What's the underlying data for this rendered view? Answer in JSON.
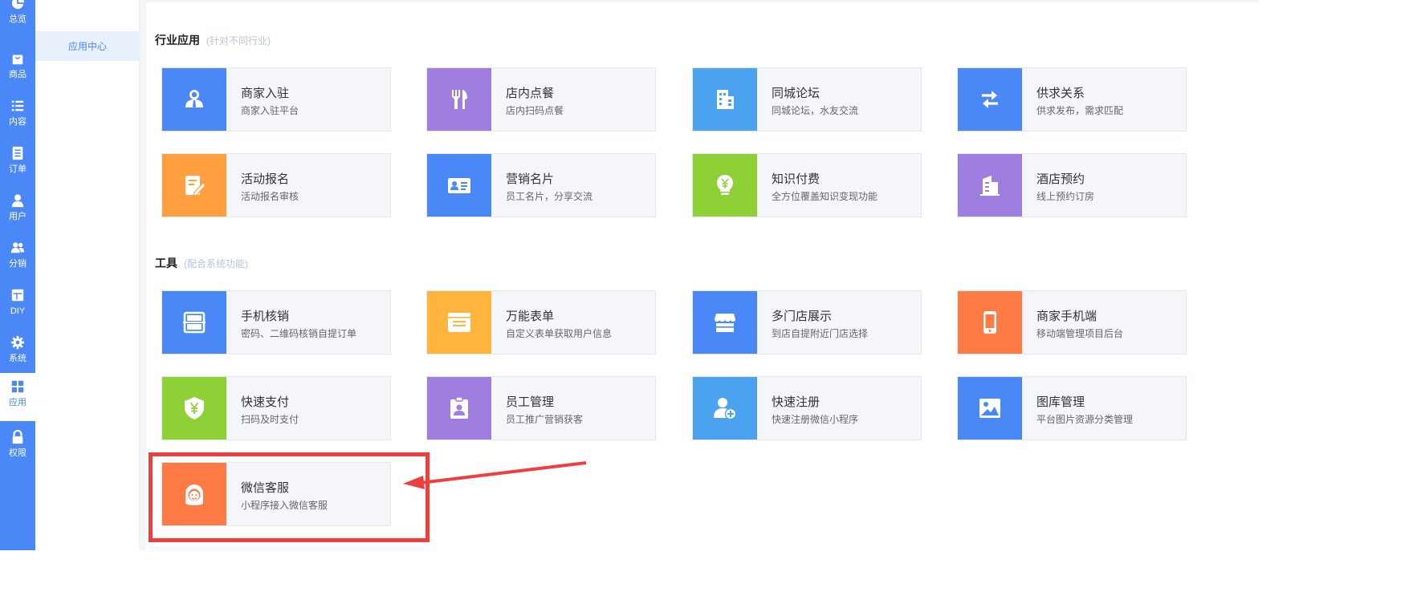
{
  "sidebar": {
    "items": [
      {
        "label": "总览",
        "icon": "pie-chart-icon"
      },
      {
        "label": "商品",
        "icon": "shopping-bag-icon"
      },
      {
        "label": "内容",
        "icon": "list-icon"
      },
      {
        "label": "订单",
        "icon": "document-icon"
      },
      {
        "label": "用户",
        "icon": "user-icon"
      },
      {
        "label": "分销",
        "icon": "users-icon"
      },
      {
        "label": "DIY",
        "icon": "layout-icon"
      },
      {
        "label": "系统",
        "icon": "gear-icon"
      },
      {
        "label": "应用",
        "icon": "apps-grid-icon",
        "active": true
      },
      {
        "label": "权限",
        "icon": "lock-icon"
      }
    ],
    "accent": "#4a88f7"
  },
  "submenu": {
    "items": [
      {
        "label": "应用中心",
        "active": true
      }
    ]
  },
  "sections": [
    {
      "title": "行业应用",
      "subtitle": "(针对不同行业)",
      "cards": [
        {
          "title": "商家入驻",
          "desc": "商家入驻平台",
          "icon": "merchant-icon",
          "color": "#4a88f7"
        },
        {
          "title": "店内点餐",
          "desc": "店内扫码点餐",
          "icon": "fork-knife-icon",
          "color": "#a07ee0"
        },
        {
          "title": "同城论坛",
          "desc": "同城论坛，水友交流",
          "icon": "building-icon",
          "color": "#4ba3ef"
        },
        {
          "title": "供求关系",
          "desc": "供求发布，需求匹配",
          "icon": "exchange-arrows-icon",
          "color": "#4a88f7"
        },
        {
          "title": "活动报名",
          "desc": "活动报名审核",
          "icon": "edit-form-icon",
          "color": "#ff9f40"
        },
        {
          "title": "营销名片",
          "desc": "员工名片，分享交流",
          "icon": "id-card-icon",
          "color": "#4a88f7"
        },
        {
          "title": "知识付费",
          "desc": "全方位覆盖知识变现功能",
          "icon": "lightbulb-yuan-icon",
          "color": "#8ed136"
        },
        {
          "title": "酒店预约",
          "desc": "线上预约订房",
          "icon": "hotel-icon",
          "color": "#a07ee0"
        }
      ]
    },
    {
      "title": "工具",
      "subtitle": "(配合系统功能)",
      "cards": [
        {
          "title": "手机核销",
          "desc": "密码、二维码核销自提订单",
          "icon": "scan-icon",
          "color": "#4a88f7"
        },
        {
          "title": "万能表单",
          "desc": "自定义表单获取用户信息",
          "icon": "form-icon",
          "color": "#ffb53d"
        },
        {
          "title": "多门店展示",
          "desc": "到店自提附近门店选择",
          "icon": "store-icon",
          "color": "#4a88f7"
        },
        {
          "title": "商家手机端",
          "desc": "移动端管理项目后台",
          "icon": "mobile-icon",
          "color": "#ff7b45"
        },
        {
          "title": "快速支付",
          "desc": "扫码及时支付",
          "icon": "shield-yuan-icon",
          "color": "#8ed136"
        },
        {
          "title": "员工管理",
          "desc": "员工推广营销获客",
          "icon": "badge-icon",
          "color": "#a07ee0"
        },
        {
          "title": "快速注册",
          "desc": "快速注册微信小程序",
          "icon": "user-add-icon",
          "color": "#4ba3ef"
        },
        {
          "title": "图库管理",
          "desc": "平台图片资源分类管理",
          "icon": "image-icon",
          "color": "#4a88f7"
        },
        {
          "title": "微信客服",
          "desc": "小程序接入微信客服",
          "icon": "customer-service-icon",
          "color": "#ff7b45"
        }
      ]
    }
  ],
  "annotation_color": "#ee3f3f"
}
